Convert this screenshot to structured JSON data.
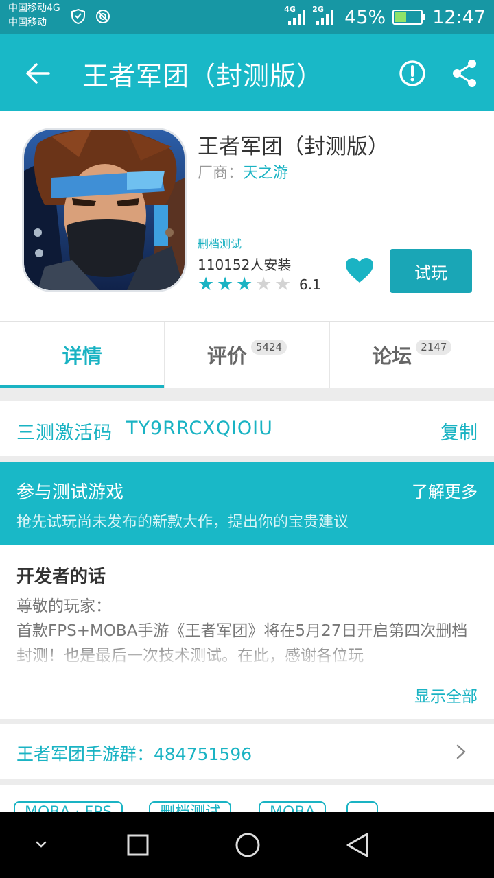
{
  "status_bar": {
    "carrier1": "中国移动4G",
    "carrier2": "中国移动",
    "net1": "4G",
    "net2": "2G",
    "battery_text": "45%",
    "battery_level": 0.45,
    "time": "12:47"
  },
  "titlebar": {
    "title": "王者军团（封测版）"
  },
  "app": {
    "name": "王者军团（封测版）",
    "vendor_label": "厂商：",
    "vendor": "天之游",
    "test_badge": "删档测试",
    "installs": "110152人安装",
    "rating": "6.1",
    "stars_filled": 3,
    "stars_total": 5,
    "play_label": "试玩"
  },
  "tabs": [
    {
      "label": "详情",
      "count": ""
    },
    {
      "label": "评价",
      "count": "5424"
    },
    {
      "label": "论坛",
      "count": "2147"
    }
  ],
  "activation": {
    "label": "三测激活码",
    "code": "TY9RRCXQIOIU",
    "copy_label": "复制"
  },
  "test_banner": {
    "title": "参与测试游戏",
    "more": "了解更多",
    "subtitle": "抢先试玩尚未发布的新款大作，提出你的宝贵建议"
  },
  "developer": {
    "title": "开发者的话",
    "body": "尊敬的玩家：\n首款FPS+MOBA手游《王者军团》将在5月27日开启第四次删档封测！也是最后一次技术测试。在此，感谢各位玩",
    "show_all": "显示全部"
  },
  "group": {
    "text": "王者军团手游群：484751596"
  },
  "tags": [
    "MOBA · FPS",
    "删档测试",
    "MOBA",
    ""
  ],
  "colors": {
    "accent": "#1ab3c3",
    "header": "#19b8c7",
    "statusbar": "#1797a4"
  }
}
